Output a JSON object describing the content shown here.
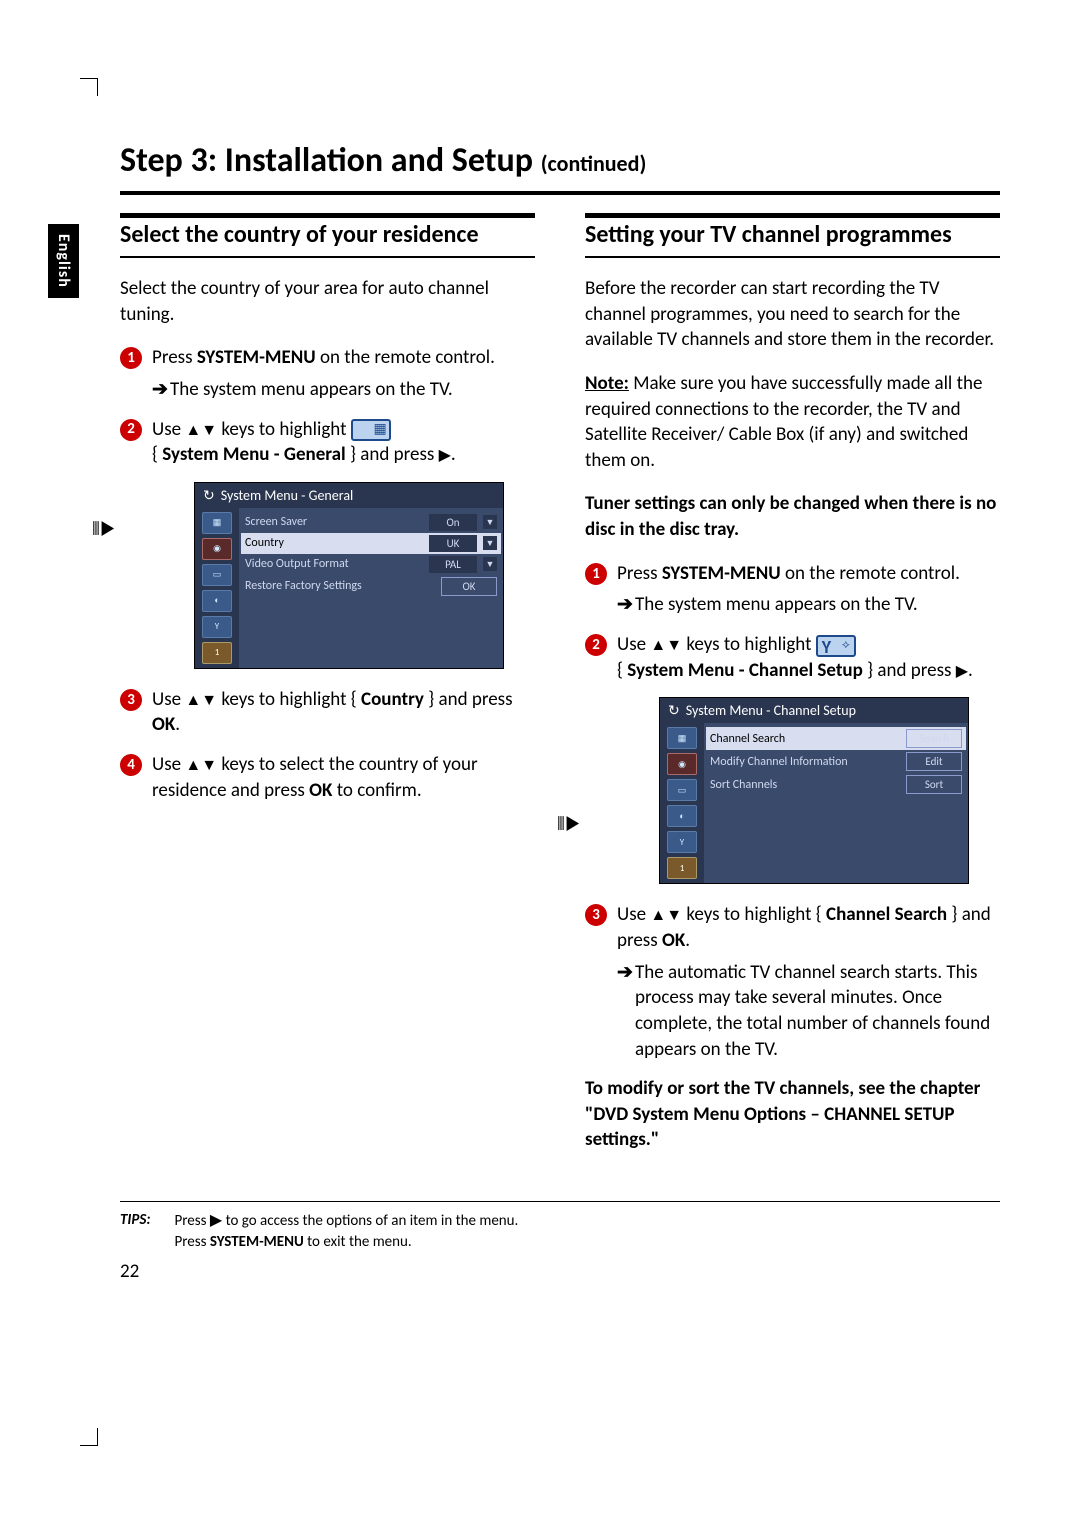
{
  "lang_tab": "English",
  "page_title_main": "Step 3: Installation and Setup",
  "page_title_cont": "(continued)",
  "left": {
    "heading": "Select the country of your residence",
    "intro": "Select the country of your area for auto channel tuning.",
    "step1_a": "Press ",
    "step1_b": "SYSTEM-MENU",
    "step1_c": " on the remote control.",
    "step1_result": "The system menu appears on the TV.",
    "step2_a": "Use ",
    "step2_keys": "▲▼",
    "step2_b": " keys to highlight ",
    "step2_menu": "System Menu - General",
    "step2_c": " } and press ",
    "step2_key2": "▶",
    "step2_d": ".",
    "osd_title": "System Menu - General",
    "osd_rows": {
      "r0": {
        "label": "Screen Saver",
        "val": "On"
      },
      "r1": {
        "label": "Country",
        "val": "UK"
      },
      "r2": {
        "label": "Video Output Format",
        "val": "PAL"
      },
      "r3": {
        "label": "Restore Factory Settings",
        "val": "OK"
      }
    },
    "step3_a": "Use ",
    "step3_keys": "▲▼",
    "step3_b": " keys to highlight { ",
    "step3_target": "Country",
    "step3_c": " } and press ",
    "step3_ok": "OK",
    "step3_d": ".",
    "step4_a": "Use ",
    "step4_keys": "▲▼",
    "step4_b": " keys to select the country of your residence and press ",
    "step4_ok": "OK",
    "step4_c": " to confirm."
  },
  "right": {
    "heading": "Setting your  TV channel programmes",
    "intro": "Before the recorder can start recording the TV channel programmes, you need to search for the available TV channels and store them in the recorder.",
    "note_label": "Note:",
    "note_body": " Make sure you have successfully made all the required connections to the recorder, the TV and Satellite Receiver/ Cable Box (if any) and switched them on.",
    "warn": "Tuner settings can only be changed when there is no disc in the disc tray.",
    "step1_a": "Press ",
    "step1_b": "SYSTEM-MENU",
    "step1_c": " on the remote control.",
    "step1_result": "The system menu appears on the TV.",
    "step2_a": "Use ",
    "step2_keys": "▲▼",
    "step2_b": " keys to highlight ",
    "step2_menu": "System Menu - Channel Setup",
    "step2_c": " } and press ",
    "step2_key2": "▶",
    "step2_d": ".",
    "osd_title": "System Menu - Channel Setup",
    "osd_rows": {
      "r0": {
        "label": "Channel Search",
        "val": "Search"
      },
      "r1": {
        "label": "Modify Channel Information",
        "val": "Edit"
      },
      "r2": {
        "label": "Sort Channels",
        "val": "Sort"
      }
    },
    "step3_a": "Use ",
    "step3_keys": "▲▼",
    "step3_b": " keys to highlight { ",
    "step3_target": "Channel Search",
    "step3_c": " } and press ",
    "step3_ok": "OK",
    "step3_d": ".",
    "step3_result": "The automatic TV channel search starts. This process may take several minutes. Once complete, the total number of channels found appears on the TV.",
    "closing": "To modify or sort the TV channels, see the chapter \"DVD System Menu Options – CHANNEL SETUP settings.\""
  },
  "tips": {
    "label": "TIPS:",
    "line1_a": "Press ",
    "line1_key": "▶",
    "line1_b": " to go access the options of an item in the menu.",
    "line2_a": "Press ",
    "line2_b": "SYSTEM-MENU",
    "line2_c": " to exit the menu."
  },
  "page_number": "22",
  "nums": {
    "n1": "1",
    "n2": "2",
    "n3": "3",
    "n4": "4"
  },
  "osd_icons": {
    "i5": "1"
  }
}
